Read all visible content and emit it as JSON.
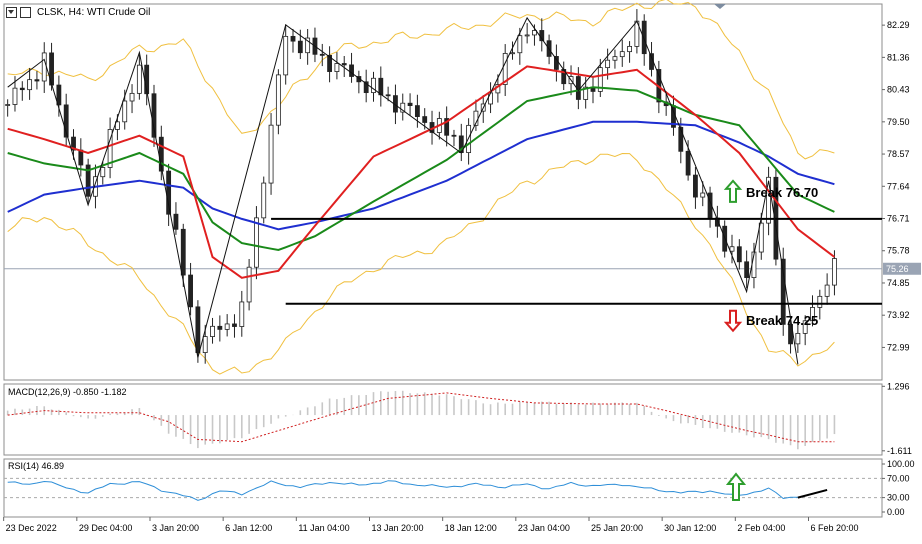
{
  "header": {
    "symbol_label": "CLSK, H4:  WTI Crude Oil"
  },
  "colors": {
    "candle": "#222222",
    "bollinger": "#f0c040",
    "ma_fast": "#e02020",
    "ma_mid": "#1a8a1a",
    "ma_slow": "#1f2fd0",
    "level_line": "#000000",
    "current_price_line": "#9aa4b4",
    "macd_hist": "#c8c8c8",
    "macd_signal": "#d02020",
    "rsi_line": "#2f8fd8",
    "arrow_up": "#2e9e2e",
    "arrow_down": "#d92020"
  },
  "chart_data": [
    {
      "type": "candlestick",
      "title": "CLSK, H4:  WTI Crude Oil",
      "ylim": [
        72.05,
        82.9
      ],
      "y_ticks": [
        82.29,
        81.36,
        80.43,
        79.5,
        78.57,
        77.64,
        76.71,
        75.78,
        74.85,
        73.92,
        72.99
      ],
      "current_price": 75.26,
      "current_price_label": "75.26",
      "levels": [
        {
          "name": "break-up",
          "price": 76.7,
          "label": "Break 76.70",
          "direction": "up"
        },
        {
          "name": "break-down",
          "price": 74.25,
          "label": "Break 74.25",
          "direction": "down"
        }
      ],
      "x_labels": [
        "23 Dec 2022",
        "29 Dec 04:00",
        "3 Jan 20:00",
        "6 Jan 12:00",
        "11 Jan 04:00",
        "13 Jan 20:00",
        "18 Jan 12:00",
        "23 Jan 04:00",
        "25 Jan 20:00",
        "30 Jan 12:00",
        "2 Feb 04:00",
        "6 Feb 20:00"
      ],
      "x_label_index": [
        0,
        10,
        20,
        30,
        40,
        50,
        60,
        70,
        80,
        90,
        100,
        110
      ],
      "swing_points": [
        [
          0,
          80.5
        ],
        [
          5,
          81.3
        ],
        [
          11,
          77.1
        ],
        [
          18,
          81.5
        ],
        [
          26,
          72.7
        ],
        [
          38,
          82.3
        ],
        [
          62,
          78.6
        ],
        [
          71,
          82.5
        ],
        [
          78,
          80.4
        ],
        [
          86,
          82.4
        ],
        [
          101,
          74.6
        ],
        [
          104,
          77.8
        ],
        [
          108,
          72.5
        ]
      ],
      "price_path": [
        [
          0,
          80.0
        ],
        [
          5,
          81.2
        ],
        [
          11,
          77.4
        ],
        [
          18,
          81.1
        ],
        [
          26,
          73.1
        ],
        [
          32,
          74.0
        ],
        [
          38,
          82.0
        ],
        [
          62,
          78.9
        ],
        [
          71,
          82.3
        ],
        [
          78,
          80.2
        ],
        [
          86,
          82.1
        ],
        [
          94,
          77.5
        ],
        [
          101,
          75.0
        ],
        [
          104,
          77.6
        ],
        [
          106,
          73.6
        ],
        [
          108,
          73.2
        ],
        [
          111,
          74.6
        ],
        [
          113,
          75.26
        ]
      ],
      "ma_fast_path": [
        [
          0,
          79.3
        ],
        [
          5,
          79.0
        ],
        [
          11,
          78.6
        ],
        [
          18,
          79.1
        ],
        [
          24,
          78.5
        ],
        [
          28,
          75.6
        ],
        [
          32,
          75.0
        ],
        [
          37,
          75.2
        ],
        [
          42,
          76.5
        ],
        [
          50,
          78.5
        ],
        [
          60,
          79.5
        ],
        [
          71,
          81.1
        ],
        [
          80,
          80.8
        ],
        [
          86,
          81.0
        ],
        [
          94,
          79.7
        ],
        [
          100,
          78.6
        ],
        [
          104,
          77.5
        ],
        [
          108,
          76.4
        ],
        [
          113,
          75.6
        ]
      ],
      "ma_mid_path": [
        [
          0,
          78.6
        ],
        [
          5,
          78.3
        ],
        [
          11,
          78.1
        ],
        [
          18,
          78.6
        ],
        [
          24,
          78.0
        ],
        [
          28,
          76.6
        ],
        [
          32,
          76.0
        ],
        [
          37,
          75.8
        ],
        [
          42,
          76.2
        ],
        [
          50,
          77.2
        ],
        [
          60,
          78.4
        ],
        [
          71,
          80.1
        ],
        [
          80,
          80.5
        ],
        [
          86,
          80.4
        ],
        [
          94,
          79.7
        ],
        [
          100,
          79.4
        ],
        [
          104,
          78.4
        ],
        [
          108,
          77.4
        ],
        [
          113,
          76.9
        ]
      ],
      "ma_slow_path": [
        [
          0,
          76.9
        ],
        [
          5,
          77.4
        ],
        [
          11,
          77.6
        ],
        [
          18,
          77.8
        ],
        [
          24,
          77.6
        ],
        [
          28,
          77.0
        ],
        [
          32,
          76.7
        ],
        [
          37,
          76.4
        ],
        [
          42,
          76.6
        ],
        [
          50,
          77.0
        ],
        [
          60,
          77.8
        ],
        [
          71,
          79.0
        ],
        [
          80,
          79.5
        ],
        [
          86,
          79.5
        ],
        [
          94,
          79.4
        ],
        [
          100,
          78.9
        ],
        [
          104,
          78.5
        ],
        [
          108,
          78.0
        ],
        [
          113,
          77.7
        ]
      ],
      "bb_upper_path": [
        [
          0,
          80.8
        ],
        [
          5,
          81.0
        ],
        [
          11,
          80.7
        ],
        [
          18,
          81.6
        ],
        [
          24,
          81.8
        ],
        [
          28,
          80.5
        ],
        [
          32,
          79.0
        ],
        [
          38,
          80.2
        ],
        [
          44,
          81.5
        ],
        [
          50,
          81.8
        ],
        [
          56,
          82.0
        ],
        [
          62,
          82.2
        ],
        [
          71,
          82.6
        ],
        [
          80,
          82.4
        ],
        [
          86,
          82.9
        ],
        [
          94,
          82.9
        ],
        [
          100,
          81.5
        ],
        [
          104,
          80.3
        ],
        [
          108,
          78.6
        ],
        [
          113,
          78.6
        ]
      ],
      "bb_lower_path": [
        [
          0,
          76.4
        ],
        [
          5,
          76.8
        ],
        [
          11,
          76.0
        ],
        [
          18,
          75.0
        ],
        [
          24,
          73.5
        ],
        [
          28,
          72.4
        ],
        [
          32,
          72.2
        ],
        [
          38,
          73.1
        ],
        [
          44,
          74.5
        ],
        [
          50,
          75.3
        ],
        [
          60,
          76.0
        ],
        [
          71,
          77.8
        ],
        [
          80,
          78.5
        ],
        [
          86,
          78.5
        ],
        [
          94,
          76.6
        ],
        [
          100,
          74.5
        ],
        [
          104,
          72.9
        ],
        [
          108,
          72.6
        ],
        [
          113,
          73.0
        ]
      ]
    },
    {
      "type": "bar",
      "title": "MACD(12,26,9) -0.850 -1.182",
      "ylim": [
        -1.8,
        1.4
      ],
      "y_ticks": [
        1.296,
        -1.611
      ],
      "hist_path": [
        [
          0,
          0.2
        ],
        [
          5,
          0.4
        ],
        [
          11,
          -0.2
        ],
        [
          18,
          0.3
        ],
        [
          22,
          -0.8
        ],
        [
          26,
          -1.45
        ],
        [
          32,
          -1.0
        ],
        [
          37,
          -0.2
        ],
        [
          44,
          0.7
        ],
        [
          52,
          1.1
        ],
        [
          60,
          0.9
        ],
        [
          66,
          0.5
        ],
        [
          72,
          0.6
        ],
        [
          78,
          0.5
        ],
        [
          86,
          0.55
        ],
        [
          90,
          -0.2
        ],
        [
          96,
          -0.6
        ],
        [
          101,
          -0.9
        ],
        [
          104,
          -1.1
        ],
        [
          108,
          -1.5
        ],
        [
          113,
          -0.9
        ]
      ],
      "signal_path": [
        [
          0,
          0.0
        ],
        [
          5,
          0.2
        ],
        [
          11,
          0.1
        ],
        [
          18,
          0.1
        ],
        [
          22,
          -0.3
        ],
        [
          26,
          -1.1
        ],
        [
          32,
          -1.2
        ],
        [
          37,
          -0.7
        ],
        [
          44,
          0.0
        ],
        [
          52,
          0.75
        ],
        [
          60,
          1.0
        ],
        [
          66,
          0.75
        ],
        [
          72,
          0.55
        ],
        [
          80,
          0.5
        ],
        [
          86,
          0.5
        ],
        [
          90,
          0.2
        ],
        [
          96,
          -0.3
        ],
        [
          101,
          -0.7
        ],
        [
          104,
          -0.9
        ],
        [
          108,
          -1.2
        ],
        [
          113,
          -1.2
        ]
      ]
    },
    {
      "type": "line",
      "title": "RSI(14) 46.89",
      "ylim": [
        0,
        100
      ],
      "y_ticks": [
        100.0,
        70.0,
        30.0,
        0.0
      ],
      "y_tick_labels": [
        "100.00",
        "70.00",
        "30.00",
        "0.00"
      ],
      "reference_levels": [
        70,
        30
      ],
      "rsi_path": [
        [
          0,
          62
        ],
        [
          3,
          57
        ],
        [
          5,
          66
        ],
        [
          8,
          50
        ],
        [
          11,
          40
        ],
        [
          14,
          58
        ],
        [
          18,
          63
        ],
        [
          21,
          46
        ],
        [
          24,
          34
        ],
        [
          26,
          25
        ],
        [
          29,
          44
        ],
        [
          32,
          38
        ],
        [
          36,
          62
        ],
        [
          40,
          52
        ],
        [
          44,
          62
        ],
        [
          48,
          56
        ],
        [
          52,
          64
        ],
        [
          55,
          58
        ],
        [
          60,
          52
        ],
        [
          64,
          58
        ],
        [
          68,
          52
        ],
        [
          71,
          58
        ],
        [
          74,
          48
        ],
        [
          77,
          60
        ],
        [
          80,
          54
        ],
        [
          84,
          58
        ],
        [
          86,
          52
        ],
        [
          89,
          46
        ],
        [
          92,
          40
        ],
        [
          96,
          44
        ],
        [
          99,
          34
        ],
        [
          101,
          38
        ],
        [
          104,
          48
        ],
        [
          106,
          30
        ],
        [
          108,
          32
        ]
      ],
      "divergence_line": [
        [
          108,
          30
        ],
        [
          112,
          46
        ]
      ],
      "arrow": "up"
    }
  ]
}
